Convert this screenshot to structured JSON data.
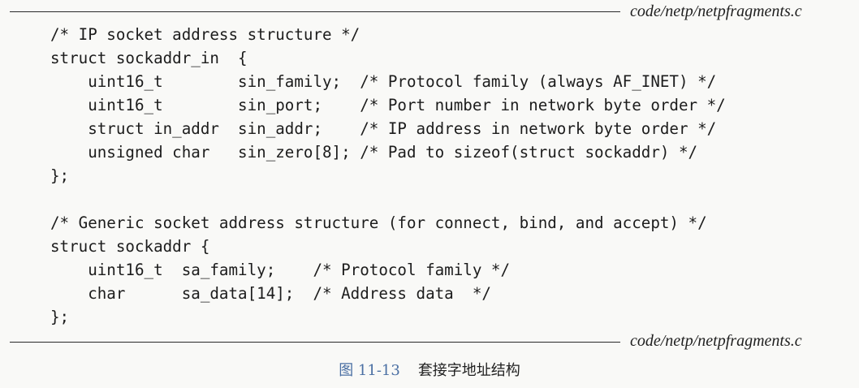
{
  "header": {
    "file_label": "code/netp/netpfragments.c"
  },
  "code_lines": [
    "/* IP socket address structure */",
    "struct sockaddr_in  {",
    "    uint16_t        sin_family;  /* Protocol family (always AF_INET) */",
    "    uint16_t        sin_port;    /* Port number in network byte order */",
    "    struct in_addr  sin_addr;    /* IP address in network byte order */",
    "    unsigned char   sin_zero[8]; /* Pad to sizeof(struct sockaddr) */",
    "};",
    "",
    "/* Generic socket address structure (for connect, bind, and accept) */",
    "struct sockaddr {",
    "    uint16_t  sa_family;    /* Protocol family */",
    "    char      sa_data[14];  /* Address data  */",
    "};"
  ],
  "footer": {
    "file_label": "code/netp/netpfragments.c"
  },
  "caption": {
    "label": "图 11-13",
    "title": "套接字地址结构"
  },
  "colors": {
    "caption_label": "#4a6fa3",
    "text": "#1f1f1f",
    "background": "#f9f9f7"
  }
}
